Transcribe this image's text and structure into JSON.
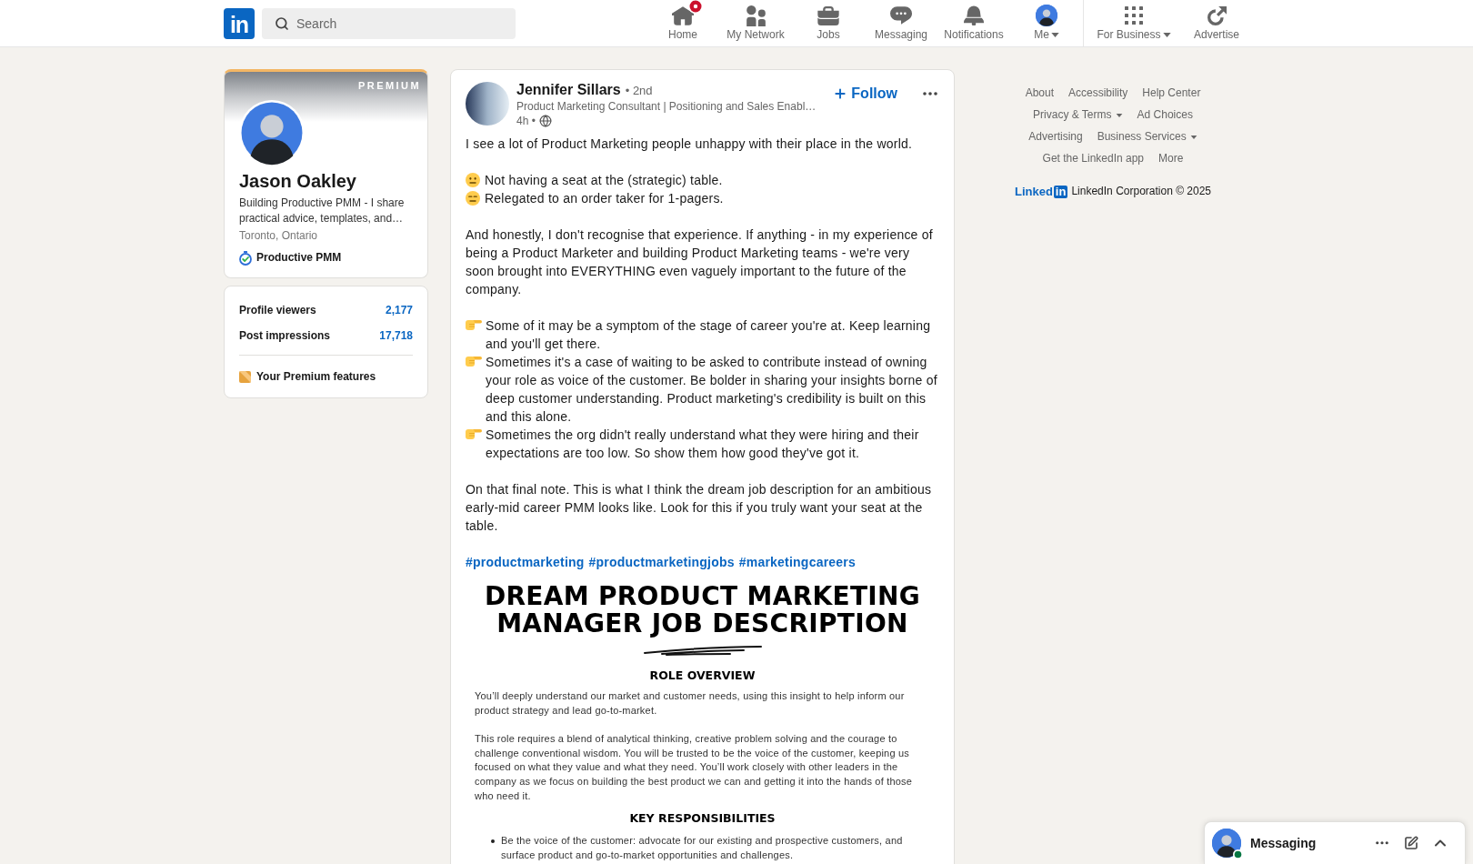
{
  "nav": {
    "logo": "in",
    "search": {
      "placeholder": "Search"
    },
    "items": [
      {
        "label": "Home",
        "badge": true,
        "dropdown": false
      },
      {
        "label": "My Network",
        "badge": false,
        "dropdown": false
      },
      {
        "label": "Jobs",
        "badge": false,
        "dropdown": false
      },
      {
        "label": "Messaging",
        "badge": false,
        "dropdown": false
      },
      {
        "label": "Notifications",
        "badge": false,
        "dropdown": false
      },
      {
        "label": "Me",
        "badge": false,
        "dropdown": true
      }
    ],
    "work_items": [
      {
        "label": "For Business",
        "dropdown": true
      },
      {
        "label": "Advertise",
        "dropdown": false
      }
    ]
  },
  "profile_card": {
    "banner_label": "PREMIUM",
    "name": "Jason Oakley",
    "headline": "Building Productive PMM - I share practical advice, templates, and…",
    "location": "Toronto, Ontario",
    "company": "Productive PMM"
  },
  "stats_card": {
    "stats": [
      {
        "label": "Profile viewers",
        "value": "2,177"
      },
      {
        "label": "Post impressions",
        "value": "17,718"
      }
    ],
    "premium_link": "Your Premium features"
  },
  "post": {
    "author": {
      "name": "Jennifer Sillars",
      "degree": "• 2nd",
      "headline": "Product Marketing Consultant | Positioning and Sales Enabl…",
      "time": "4h •"
    },
    "follow_button": "Follow",
    "paragraphs": [
      {
        "lines": [
          {
            "kind": "text",
            "text": "I see a lot of Product Marketing people unhappy with their place in the world."
          }
        ]
      },
      {
        "lines": [
          {
            "kind": "neutral",
            "text": "Not having a seat at the (strategic) table."
          },
          {
            "kind": "expressionless",
            "text": "Relegated to an order taker for 1-pagers."
          }
        ]
      },
      {
        "lines": [
          {
            "kind": "text",
            "text": "And honestly, I don't recognise that experience. If anything - in my experience of being a Product Marketer and building Product Marketing teams - we're very soon brought into EVERYTHING even vaguely important to the future of the company."
          }
        ]
      },
      {
        "lines": [
          {
            "kind": "pointing",
            "text": "Some of it may be a symptom of the stage of career you're at. Keep learning and you'll get there."
          },
          {
            "kind": "pointing",
            "text": "Sometimes it's a case of waiting to be asked to contribute instead of owning your role as voice of the customer. Be bolder in sharing your insights borne of deep customer understanding. Product marketing's credibility is built on this and this alone."
          },
          {
            "kind": "pointing",
            "text": "Sometimes the org didn't really understand what they were hiring and their expectations are too low. So show them how good they've got it."
          }
        ]
      },
      {
        "lines": [
          {
            "kind": "text",
            "text": "On that final note. This is what I think the dream job description for an ambitious early-mid career PMM looks like. Look for this if you truly want your seat at the table."
          }
        ]
      }
    ],
    "hashtags": [
      "#productmarketing",
      "#productmarketingjobs",
      "#marketingcareers"
    ],
    "document": {
      "title": "DREAM PRODUCT MARKETING MANAGER JOB DESCRIPTION",
      "sections": [
        {
          "heading": "ROLE OVERVIEW",
          "paragraphs": [
            "You’ll deeply understand our market and customer needs, using this insight to help inform our product strategy and lead go-to-market.",
            "This role requires a blend of analytical thinking, creative problem solving and the courage to challenge conventional wisdom. You will be trusted to be the voice of the customer, keeping us focused on what they value and what they need. You’ll work closely with other leaders in the company as we focus on building the best product we can and getting it into the hands of those who need it."
          ]
        },
        {
          "heading": "KEY RESPONSIBILITIES",
          "bullets": [
            "Be the voice of the customer: advocate for our existing and prospective customers, and surface product and go-to-market opportunities and challenges."
          ]
        }
      ]
    }
  },
  "footer": {
    "links": [
      {
        "label": "About",
        "dropdown": false
      },
      {
        "label": "Accessibility",
        "dropdown": false
      },
      {
        "label": "Help Center",
        "dropdown": false
      },
      {
        "label": "Privacy & Terms",
        "dropdown": true
      },
      {
        "label": "Ad Choices",
        "dropdown": false
      },
      {
        "label": "Advertising",
        "dropdown": false
      },
      {
        "label": "Business Services",
        "dropdown": true
      },
      {
        "label": "Get the LinkedIn app",
        "dropdown": false
      },
      {
        "label": "More",
        "dropdown": false
      }
    ],
    "logo": {
      "word": "Linked",
      "box": "in"
    },
    "copyright": "LinkedIn Corporation © 2025"
  },
  "messaging": {
    "label": "Messaging",
    "online": true
  }
}
